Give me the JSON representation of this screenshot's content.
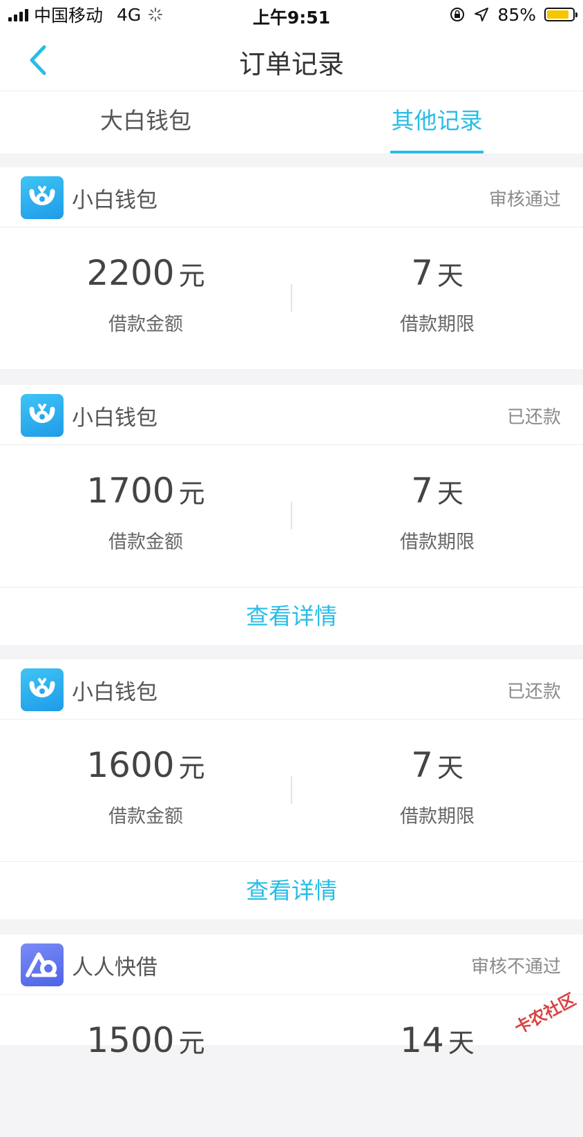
{
  "status_bar": {
    "carrier": "中国移动",
    "network": "4G",
    "time": "上午9:51",
    "battery": "85%",
    "battery_level": 0.85,
    "battery_color": "#f7c600"
  },
  "nav": {
    "title": "订单记录"
  },
  "tabs": [
    {
      "label": "大白钱包",
      "active": false
    },
    {
      "label": "其他记录",
      "active": true
    }
  ],
  "accent_color": "#27bde6",
  "orders": [
    {
      "product": "小白钱包",
      "status": "审核通过",
      "amount": "2200",
      "amount_unit": "元",
      "amount_label": "借款金额",
      "term": "7",
      "term_unit": "天",
      "term_label": "借款期限"
    },
    {
      "product": "小白钱包",
      "status": "已还款",
      "amount": "1700",
      "amount_unit": "元",
      "amount_label": "借款金额",
      "term": "7",
      "term_unit": "天",
      "term_label": "借款期限",
      "detail": "查看详情"
    },
    {
      "product": "小白钱包",
      "status": "已还款",
      "amount": "1600",
      "amount_unit": "元",
      "amount_label": "借款金额",
      "term": "7",
      "term_unit": "天",
      "term_label": "借款期限",
      "detail": "查看详情"
    },
    {
      "product": "人人快借",
      "status": "审核不通过",
      "amount": "1500",
      "amount_unit": "元",
      "term": "14",
      "term_unit": "天"
    }
  ],
  "watermark": "卡农社区"
}
